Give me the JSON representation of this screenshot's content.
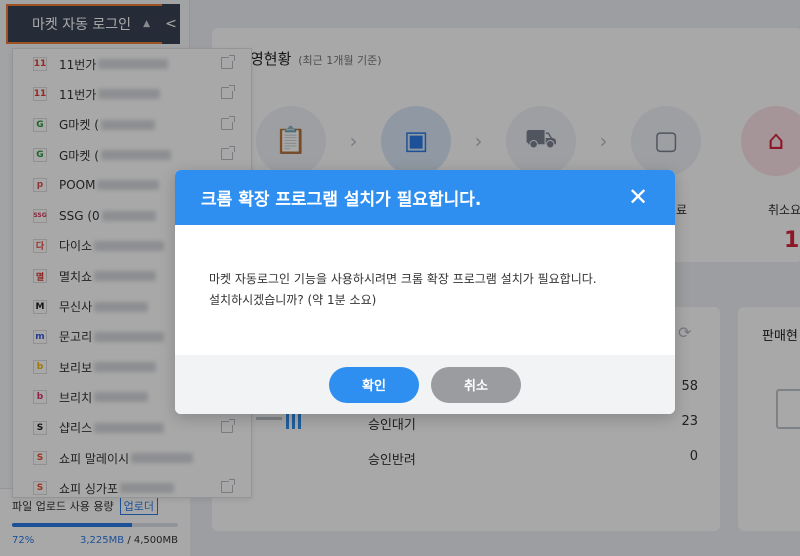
{
  "sidebar": {
    "market_login_label": "마켓 자동 로그인",
    "collapse_glyph": "<",
    "caret_glyph": "▲"
  },
  "dropdown": {
    "items": [
      {
        "logo": "11",
        "logo_color": "#e83a3a",
        "name": "11번가",
        "ext": true
      },
      {
        "logo": "11",
        "logo_color": "#e83a3a",
        "name": "11번가",
        "ext": true
      },
      {
        "logo": "G",
        "logo_color": "#2c9a3e",
        "name": "G마켓 (",
        "ext": true
      },
      {
        "logo": "G",
        "logo_color": "#2c9a3e",
        "name": "G마켓 (",
        "ext": true
      },
      {
        "logo": "p",
        "logo_color": "#e14b4b",
        "name": "POOM",
        "ext": false
      },
      {
        "logo": "SSG",
        "logo_color": "#d43a5a",
        "name": "SSG (0",
        "ext": false
      },
      {
        "logo": "다",
        "logo_color": "#e8433a",
        "name": "다이소",
        "ext": false
      },
      {
        "logo": "멸",
        "logo_color": "#d9342b",
        "name": "멸치쇼",
        "ext": false
      },
      {
        "logo": "M",
        "logo_color": "#222222",
        "name": "무신사",
        "ext": false
      },
      {
        "logo": "m",
        "logo_color": "#3b5bdb",
        "name": "문고리",
        "ext": false
      },
      {
        "logo": "b",
        "logo_color": "#f2b705",
        "name": "보리보",
        "ext": false
      },
      {
        "logo": "b",
        "logo_color": "#d6336c",
        "name": "브리치",
        "ext": false
      },
      {
        "logo": "S",
        "logo_color": "#222222",
        "name": "샵리스",
        "ext": true
      },
      {
        "logo": "S",
        "logo_color": "#ee4d2d",
        "name": "쇼피 말레이시",
        "ext": false
      },
      {
        "logo": "S",
        "logo_color": "#ee4d2d",
        "name": "쇼피 싱가포",
        "ext": true
      }
    ]
  },
  "upload": {
    "label": "파일 업로드 사용 용량",
    "link": "업로더",
    "percent_label": "72%",
    "percent": 72,
    "used": "3,225MB",
    "total": "/ 4,500MB"
  },
  "main": {
    "title": "영현황",
    "subtitle": "(최근 1개월 기준)",
    "right_label": "취소요",
    "right_value": "1",
    "complete_partial": "료",
    "seller_title": "판매현",
    "stats": [
      {
        "label": "",
        "value": "58"
      },
      {
        "label": "승인대기",
        "value": "23"
      },
      {
        "label": "승인반려",
        "value": "0"
      }
    ]
  },
  "modal": {
    "title": "크롬 확장 프로그램 설치가 필요합니다.",
    "body_line1": "마켓 자동로그인 기능을 사용하시려면 크롬 확장 프로그램 설치가 필요합니다.",
    "body_line2": "설치하시겠습니까? (약 1분 소요)",
    "ok_label": "확인",
    "cancel_label": "취소",
    "close_glyph": "✕"
  },
  "colors": {
    "primary": "#2f8ff0",
    "highlight_border": "#f07b36",
    "cancel_gray": "#9a9ca0",
    "danger": "#d5233b"
  }
}
